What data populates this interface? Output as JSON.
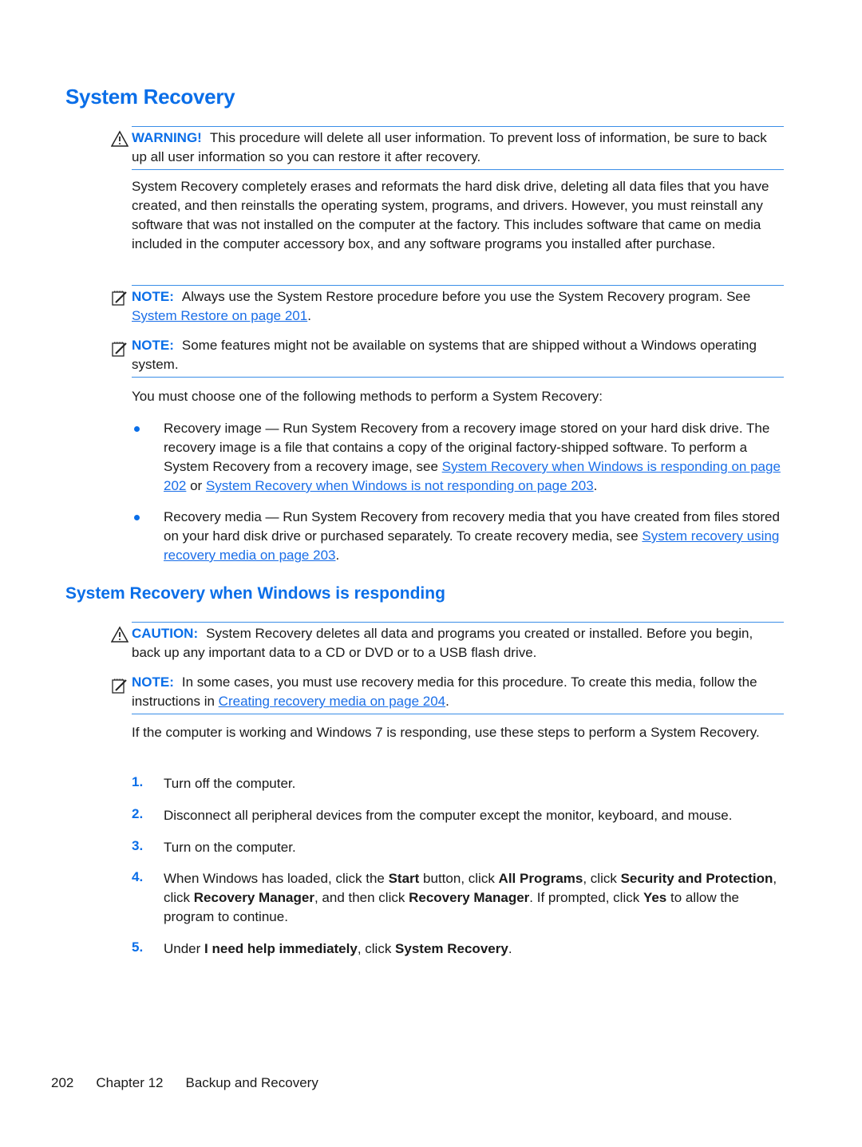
{
  "title": "System Recovery",
  "warning": {
    "label": "WARNING!",
    "text": "This procedure will delete all user information. To prevent loss of information, be sure to back up all user information so you can restore it after recovery."
  },
  "intro": "System Recovery completely erases and reformats the hard disk drive, deleting all data files that you have created, and then reinstalls the operating system, programs, and drivers. However, you must reinstall any software that was not installed on the computer at the factory. This includes software that came on media included in the computer accessory box, and any software programs you installed after purchase.",
  "note1": {
    "label": "NOTE:",
    "text": "Always use the System Restore procedure before you use the System Recovery program. See ",
    "link": "System Restore on page 201",
    "after": "."
  },
  "note2": {
    "label": "NOTE:",
    "text": "Some features might not be available on systems that are shipped without a Windows operating system."
  },
  "methods_intro": "You must choose one of the following methods to perform a System Recovery:",
  "bullets": [
    {
      "text": "Recovery image — Run System Recovery from a recovery image stored on your hard disk drive. The recovery image is a file that contains a copy of the original factory-shipped software. To perform a System Recovery from a recovery image, see ",
      "link1": "System Recovery when Windows is responding on page 202",
      "mid": " or ",
      "link2": "System Recovery when Windows is not responding on page 203",
      "after": "."
    },
    {
      "text": "Recovery media — Run System Recovery from recovery media that you have created from files stored on your hard disk drive or purchased separately. To create recovery media, see ",
      "link1": "System recovery using recovery media on page 203",
      "after": "."
    }
  ],
  "subtitle": "System Recovery when Windows is responding",
  "caution": {
    "label": "CAUTION:",
    "text": "System Recovery deletes all data and programs you created or installed. Before you begin, back up any important data to a CD or DVD or to a USB flash drive."
  },
  "note3": {
    "label": "NOTE:",
    "text": "In some cases, you must use recovery media for this procedure. To create this media, follow the instructions in ",
    "link": "Creating recovery media on page 204",
    "after": "."
  },
  "steps_intro": "If the computer is working and Windows 7 is responding, use these steps to perform a System Recovery.",
  "steps": {
    "n1": "1.",
    "s1": "Turn off the computer.",
    "n2": "2.",
    "s2": "Disconnect all peripheral devices from the computer except the monitor, keyboard, and mouse.",
    "n3": "3.",
    "s3": "Turn on the computer.",
    "n4": "4.",
    "s4": {
      "a": "When Windows has loaded, click the ",
      "b1": "Start",
      "c": " button, click ",
      "b2": "All Programs",
      "d": ", click ",
      "b3": "Security and Protection",
      "e": ", click ",
      "b4": "Recovery Manager",
      "f": ", and then click ",
      "b5": "Recovery Manager",
      "g": ". If prompted, click ",
      "b6": "Yes",
      "h": " to allow the program to continue."
    },
    "n5": "5.",
    "s5": {
      "a": "Under ",
      "b1": "I need help immediately",
      "c": ", click ",
      "b2": "System Recovery",
      "d": "."
    }
  },
  "footer": {
    "page": "202",
    "chapter": "Chapter 12",
    "section": "Backup and Recovery"
  }
}
